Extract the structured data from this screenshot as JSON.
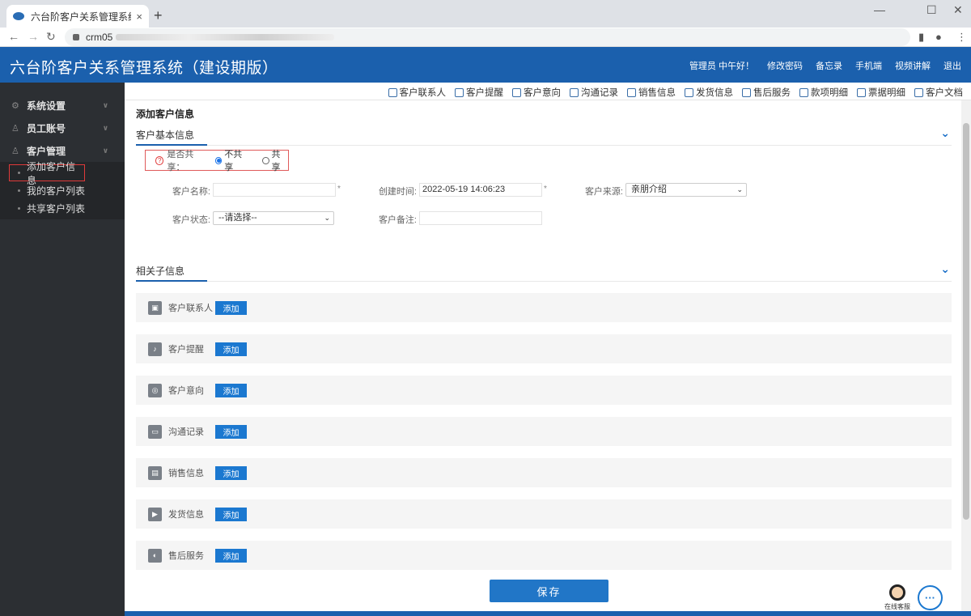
{
  "browser": {
    "tab_title": "六台阶客户关系管理系统（建设期",
    "tab_close": "×",
    "new_tab": "+",
    "url": "crm05",
    "win_min": "—",
    "win_max": "☐",
    "win_close": "✕"
  },
  "header": {
    "title": "六台阶客户关系管理系统（建设期版）",
    "greeting": "管理员 中午好！",
    "links": [
      "修改密码",
      "备忘录",
      "手机端",
      "视频讲解",
      "退出"
    ]
  },
  "sidebar": {
    "groups": [
      {
        "label": "系统设置"
      },
      {
        "label": "员工账号"
      },
      {
        "label": "客户管理"
      }
    ],
    "sub_items": [
      "添加客户信息",
      "我的客户列表",
      "共享客户列表"
    ]
  },
  "toolbar": {
    "items": [
      "客户联系人",
      "客户提醒",
      "客户意向",
      "沟通记录",
      "销售信息",
      "发货信息",
      "售后服务",
      "款项明细",
      "票据明细",
      "客户文档"
    ]
  },
  "main": {
    "page_title": "添加客户信息",
    "basic_section": "客户基本信息",
    "related_section": "相关子信息",
    "toggle_icon": "⌄",
    "share": {
      "label": "是否共享：",
      "option_no": "不共享",
      "option_yes": "共享",
      "selected": "不共享"
    },
    "form": {
      "name_label": "客户名称:",
      "name_value": "",
      "created_label": "创建时间:",
      "created_value": "2022-05-19 14:06:23",
      "source_label": "客户来源:",
      "source_value": "亲朋介绍",
      "status_label": "客户状态:",
      "status_value": "--请选择--",
      "remark_label": "客户备注:",
      "remark_value": "",
      "required_mark": "*"
    },
    "sub_cards": [
      {
        "label": "客户联系人",
        "button": "添加"
      },
      {
        "label": "客户提醒",
        "button": "添加"
      },
      {
        "label": "客户意向",
        "button": "添加"
      },
      {
        "label": "沟通记录",
        "button": "添加"
      },
      {
        "label": "销售信息",
        "button": "添加"
      },
      {
        "label": "发货信息",
        "button": "添加"
      },
      {
        "label": "售后服务",
        "button": "添加"
      }
    ],
    "save_button": "保存",
    "online_service": "在线客服",
    "chat_icon": "···"
  },
  "colors": {
    "header_bg": "#1b60ad",
    "sidebar_bg": "#2c2f33",
    "accent": "#1b78d0",
    "highlight_border": "#e03a3a"
  }
}
